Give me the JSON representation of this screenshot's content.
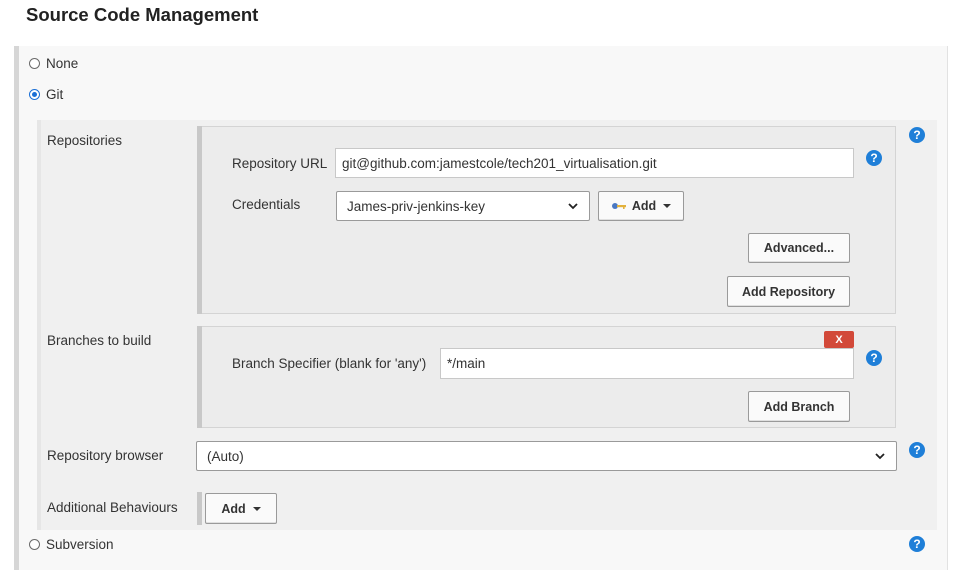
{
  "section": {
    "title": "Source Code Management"
  },
  "scm_options": {
    "none": "None",
    "git": "Git",
    "subversion": "Subversion",
    "selected": "Git"
  },
  "repositories": {
    "label": "Repositories",
    "url_label": "Repository URL",
    "url_value": "git@github.com:jamestcole/tech201_virtualisation.git",
    "credentials_label": "Credentials",
    "credentials_value": "James-priv-jenkins-key",
    "add_label": "Add",
    "advanced_label": "Advanced...",
    "add_repository_label": "Add Repository"
  },
  "branches": {
    "label": "Branches to build",
    "delete_label": "X",
    "specifier_label": "Branch Specifier (blank for 'any')",
    "specifier_value": "*/main",
    "add_branch_label": "Add Branch"
  },
  "repo_browser": {
    "label": "Repository browser",
    "value": "(Auto)"
  },
  "additional": {
    "label": "Additional Behaviours",
    "add_label": "Add"
  },
  "help": {
    "glyph": "?"
  },
  "colors": {
    "accent": "#1f7fd8",
    "delete": "#d24939"
  },
  "icons": {
    "help": "help-icon",
    "credentials": "key-icon",
    "dropdown": "chevron-down-icon"
  }
}
